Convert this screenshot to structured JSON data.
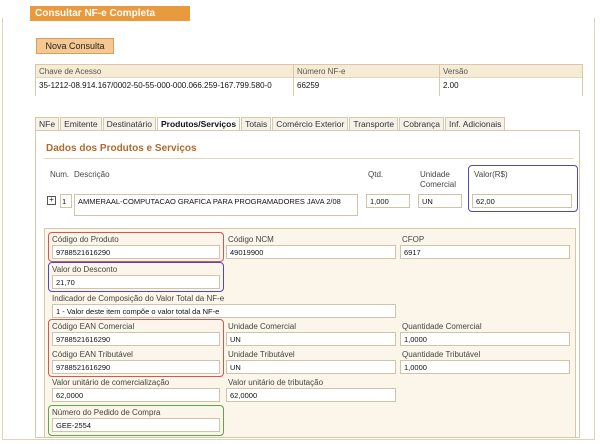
{
  "title": "Consultar NF-e Completa",
  "new_query_button": "Nova Consulta",
  "header": {
    "access_key_label": "Chave de Acesso",
    "access_key_value": "35-1212-08.914.167/0002-50-55-000-000.066.259-167.799.580-0",
    "number_label": "Número NF-e",
    "number_value": "66259",
    "version_label": "Versão",
    "version_value": "2.00"
  },
  "tabs": [
    "NFe",
    "Emitente",
    "Destinatário",
    "Produtos/Serviços",
    "Totais",
    "Comércio Exterior",
    "Transporte",
    "Cobrança",
    "Inf. Adicionais"
  ],
  "active_tab": "Produtos/Serviços",
  "section_title": "Dados dos Produtos e Serviços",
  "items_table": {
    "col_num": "Num.",
    "col_desc": "Descrição",
    "col_qty": "Qtd.",
    "col_unit": "Unidade Comercial",
    "col_value": "Valor(R$)",
    "row": {
      "num": "1",
      "desc": "AMMERAAL-COMPUTACAO GRAFICA PARA PROGRAMADORES JAVA 2/08",
      "qty": "1,000",
      "unit": "UN",
      "value": "62,00"
    }
  },
  "detail": {
    "product_code_label": "Código do Produto",
    "product_code_value": "9788521616290",
    "ncm_label": "Código NCM",
    "ncm_value": "49019900",
    "cfop_label": "CFOP",
    "cfop_value": "6917",
    "discount_label": "Valor do Desconto",
    "discount_value": "21,70",
    "composition_label": "Indicador de Composição do Valor Total da NF-e",
    "composition_value": "1 - Valor deste item compõe o valor total da NF-e",
    "ean_com_label": "Código EAN Comercial",
    "ean_com_value": "9788521616290",
    "unit_com_label": "Unidade Comercial",
    "unit_com_value": "UN",
    "qty_com_label": "Quantidade Comercial",
    "qty_com_value": "1,0000",
    "ean_trib_label": "Código EAN Tributável",
    "ean_trib_value": "9788521616290",
    "unit_trib_label": "Unidade Tributável",
    "unit_trib_value": "UN",
    "qty_trib_label": "Quantidade Tributável",
    "qty_trib_value": "1,0000",
    "unit_value_com_label": "Valor unitário de comercialização",
    "unit_value_com_value": "62,0000",
    "unit_value_trib_label": "Valor unitário de tributação",
    "unit_value_trib_value": "62,0000",
    "order_number_label": "Número do Pedido de Compra",
    "order_number_value": "GEE-2554"
  },
  "colors": {
    "title_bar": "#e89a3c",
    "section_title": "#b06a2c",
    "highlight_red": "#d9534f",
    "highlight_blue": "#4a49c4",
    "highlight_green": "#5aa84a"
  }
}
